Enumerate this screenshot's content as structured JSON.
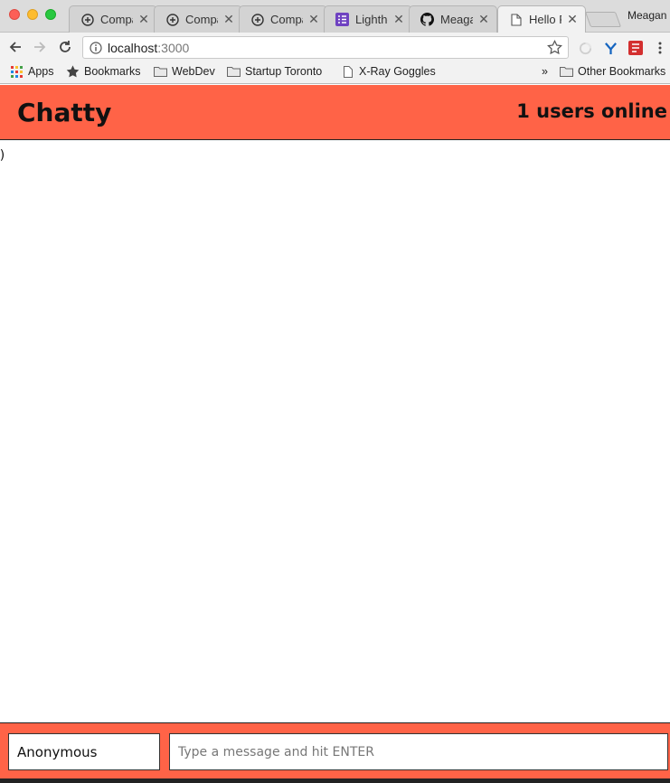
{
  "browser": {
    "tabs": [
      {
        "label": "Compa",
        "icon": "add-circle-icon",
        "active": false
      },
      {
        "label": "Compa",
        "icon": "add-circle-icon",
        "active": false
      },
      {
        "label": "Compa",
        "icon": "add-circle-icon",
        "active": false
      },
      {
        "label": "Lightho",
        "icon": "list-icon",
        "active": false
      },
      {
        "label": "Meagan",
        "icon": "github-icon",
        "active": false
      },
      {
        "label": "Hello R",
        "icon": "page-icon",
        "active": true
      }
    ],
    "profile_name": "Meagan",
    "url_host": "localhost",
    "url_port": ":3000",
    "bookmarks": {
      "apps": "Apps",
      "bookmarks": "Bookmarks",
      "webdev": "WebDev",
      "startup_toronto": "Startup Toronto",
      "xray": "X-Ray Goggles",
      "overflow": "»",
      "other": "Other Bookmarks"
    }
  },
  "app": {
    "brand": "Chatty",
    "users_online": "1 users online",
    "messages": [
      ";)"
    ],
    "username_value": "Anonymous",
    "message_placeholder": "Type a message and hit ENTER"
  },
  "colors": {
    "accent": "#ff6347",
    "github_purple": "#6f42c1"
  }
}
